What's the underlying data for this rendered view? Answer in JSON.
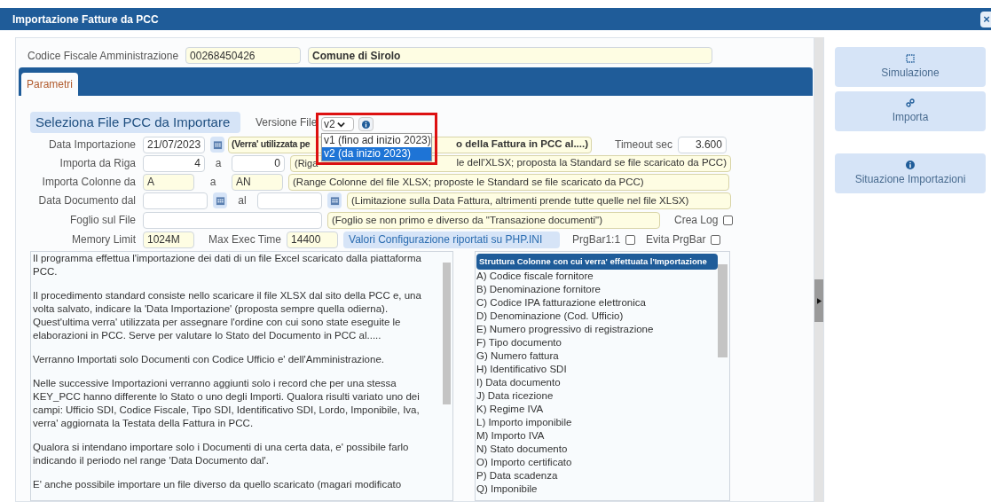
{
  "window": {
    "title": "Importazione Fatture da PCC",
    "close": "×"
  },
  "header": {
    "label": "Codice Fiscale Amministrazione",
    "codice": "00268450426",
    "ente": "Comune di Sirolo"
  },
  "tabs": [
    {
      "label": "Parametri",
      "selected": true
    }
  ],
  "section_title": "Seleziona File PCC da Importare",
  "versione": {
    "label": "Versione File",
    "value": "v2",
    "expanded": true,
    "options": [
      {
        "label": "v1 (fino ad inizio 2023)",
        "selected": false
      },
      {
        "label": "v2 (da inizio 2023)",
        "selected": true
      }
    ]
  },
  "data_importazione": {
    "label": "Data Importazione",
    "value": "21/07/2023",
    "hint_start": "(Verra' utilizzata pe",
    "hint_end": "o della Fattura in PCC al....)",
    "timeout_label": "Timeout sec",
    "timeout": "3.600"
  },
  "riga": {
    "label": "Importa da Riga",
    "from": "4",
    "sep": "a",
    "to": "0",
    "hint_start": "(Riga",
    "hint_end": "le dell'XLSX; proposta la Standard se file scaricato da PCC)"
  },
  "colonne": {
    "label": "Importa Colonne da",
    "from": "A",
    "sep": "a",
    "to": "AN",
    "hint": "(Range Colonne del file XLSX; proposte le Standard se file scaricato da PCC)"
  },
  "data_documento": {
    "label": "Data Documento dal",
    "sep": "al",
    "hint": "(Limitazione sulla Data Fattura, altrimenti prende tutte quelle nel file XLSX)"
  },
  "foglio": {
    "label": "Foglio sul File",
    "hint": "(Foglio se non primo e diverso da \"Transazione documenti\")"
  },
  "memory": {
    "label": "Memory Limit",
    "value": "1024M",
    "exec_label": "Max Exec Time",
    "exec": "14400",
    "info": "Valori Configurazione riportati su PHP.INI"
  },
  "checkboxes": [
    {
      "label": "Crea Log",
      "checked": false
    },
    {
      "label": "PrgBar1:1",
      "checked": false
    },
    {
      "label": "Evita PrgBar",
      "checked": false
    }
  ],
  "description": [
    "Il programma effettua l'importazione dei dati di un file Excel scaricato dalla piattaforma PCC.",
    "Il procedimento standard consiste nello scaricare il file XLSX dal sito della PCC e, una volta salvato, indicare la 'Data Importazione' (proposta sempre quella odierna). Quest'ultima verra' utilizzata per assegnare l'ordine con cui sono state eseguite le elaborazioni in PCC. Serve per valutare lo Stato del Documento in PCC al.....",
    "Verranno Importati solo Documenti con Codice Ufficio e' dell'Amministrazione.",
    "Nelle successive Importazioni verranno aggiunti solo i record che per una stessa KEY_PCC hanno differente lo Stato o uno degli Importi. Qualora risulti variato uno dei campi: Ufficio SDI, Codice Fiscale, Tipo SDI, Identificativo SDI, Lordo, Imponibile, Iva, verra' aggiornata la Testata della Fattura in PCC.",
    "Qualora si intendano importare solo i Documenti di una certa data, e' possibile farlo indicando il periodo nel range 'Data Documento dal'.",
    "E' anche possibile importare un file diverso da quello scaricato (magari modificato"
  ],
  "columns_list": {
    "title": "Struttura Colonne con cui verra' effettuata l'Importazione",
    "items": [
      "A) Codice fiscale fornitore",
      "B) Denominazione fornitore",
      "C) Codice IPA fatturazione elettronica",
      "D) Denominazione (Cod. Ufficio)",
      "E) Numero progressivo di registrazione",
      "F) Tipo documento",
      "G) Numero fattura",
      "H) Identificativo SDI",
      "I) Data documento",
      "J) Data ricezione",
      "K) Regime IVA",
      "L) Importo imponibile",
      "M) Importo IVA",
      "N) Stato documento",
      "O) Importo certificato",
      "P) Data scadenza",
      "Q) Imponibile"
    ]
  },
  "actions": [
    {
      "label": "Simulazione"
    },
    {
      "label": "Importa"
    },
    {
      "label": "Situazione Importazioni"
    }
  ]
}
